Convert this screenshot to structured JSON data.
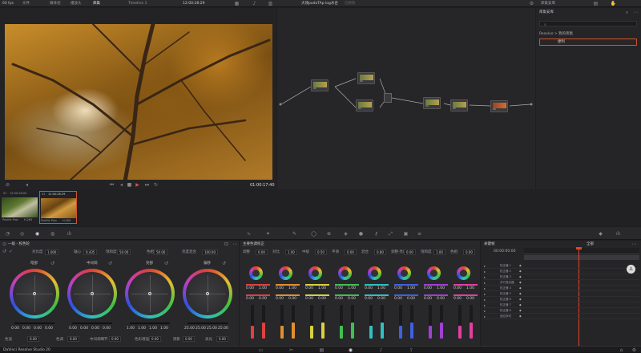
{
  "topbar": {
    "fps": "60 fps",
    "menu": [
      "文件",
      "媒体池",
      "播放头",
      "库集"
    ],
    "active": "库集",
    "timeline": "Timeline 1",
    "tc": "12:00:28:29",
    "zoom": "••",
    "title": "大领podoTAp log水合",
    "subtitle": "已修改",
    "right": "库集安库"
  },
  "viewer": {
    "timecode": "01:00:17:40"
  },
  "nodes_header": {
    "label": "节点"
  },
  "sidebar": {
    "tab1": "库集安库",
    "tab2": "库集",
    "search_icon": "search-icon",
    "path": "Resolve > 我的库集",
    "item": "便利"
  },
  "clips": [
    {
      "id": "01",
      "tc": "12:00:28:00",
      "name": "Prolific Proc",
      "codec": "H.265"
    },
    {
      "id": "02",
      "tc": "12:00:28:29",
      "name": "Prolific Proc",
      "codec": "H.265"
    }
  ],
  "wheels": {
    "title": "色轮滑块",
    "mode": "一级 - 校色轮",
    "row1": [
      {
        "l": "对比度",
        "v": "1.000"
      },
      {
        "l": "轴心",
        "v": "0.435"
      },
      {
        "l": "饱和度",
        "v": "50.00"
      },
      {
        "l": "色相",
        "v": "50.00"
      },
      {
        "l": "亮度混合",
        "v": "100.00"
      }
    ],
    "items": [
      {
        "name": "暗部",
        "vals": [
          "0.00",
          "0.00",
          "0.00",
          "0.00"
        ]
      },
      {
        "name": "中间调",
        "vals": [
          "0.00",
          "0.00",
          "0.00",
          "0.00"
        ]
      },
      {
        "name": "亮部",
        "vals": [
          "1.00",
          "1.00",
          "1.00",
          "1.00"
        ]
      },
      {
        "name": "偏移",
        "vals": [
          "25.00",
          "25.00",
          "25.00",
          "25.00"
        ]
      }
    ],
    "row2": [
      {
        "l": "色温",
        "v": "0.00"
      },
      {
        "l": "色调",
        "v": "0.00"
      },
      {
        "l": "中间调细节",
        "v": "0.00"
      },
      {
        "l": "色彩增强",
        "v": "0.00"
      },
      {
        "l": "阴影",
        "v": "0.00"
      },
      {
        "l": "高光",
        "v": "0.00"
      }
    ]
  },
  "hsl": {
    "title": "主要色调校正",
    "params": [
      {
        "l": "调整",
        "v": "0.00"
      },
      {
        "l": "对比",
        "v": "1.00"
      },
      {
        "l": "中级",
        "v": "0.50"
      },
      {
        "l": "平滑",
        "v": "0.00"
      },
      {
        "l": "混合",
        "v": "0.80"
      },
      {
        "l": "调整·亮度",
        "v": "0.00"
      },
      {
        "l": "饱和度",
        "v": "1.00"
      },
      {
        "l": "色相",
        "v": "0.00"
      }
    ],
    "channels": [
      {
        "name": "红",
        "c": "#e04040"
      },
      {
        "name": "橙",
        "c": "#e09030"
      },
      {
        "name": "黄",
        "c": "#d8d040"
      },
      {
        "name": "绿",
        "c": "#40c050"
      },
      {
        "name": "青",
        "c": "#30c0c0"
      },
      {
        "name": "蓝",
        "c": "#4060e0"
      },
      {
        "name": "紫",
        "c": "#a040d0"
      },
      {
        "name": "品红",
        "c": "#e040a0"
      }
    ],
    "chan_vals": [
      "0.00",
      "1.00",
      "0.00",
      "0.00"
    ]
  },
  "keyframes": {
    "title": "关键帧",
    "mode": "全部",
    "tc": "00:00:00:00",
    "tracks": [
      "校正器 1",
      "校正器 2",
      "校正器 3",
      "并行混合器",
      "校正器 4",
      "校正器 5",
      "校正器 6",
      "校正器 7",
      "校正器 8",
      "适应序列"
    ]
  },
  "footer": {
    "app": "DaVinci Resolve Studio 20"
  }
}
